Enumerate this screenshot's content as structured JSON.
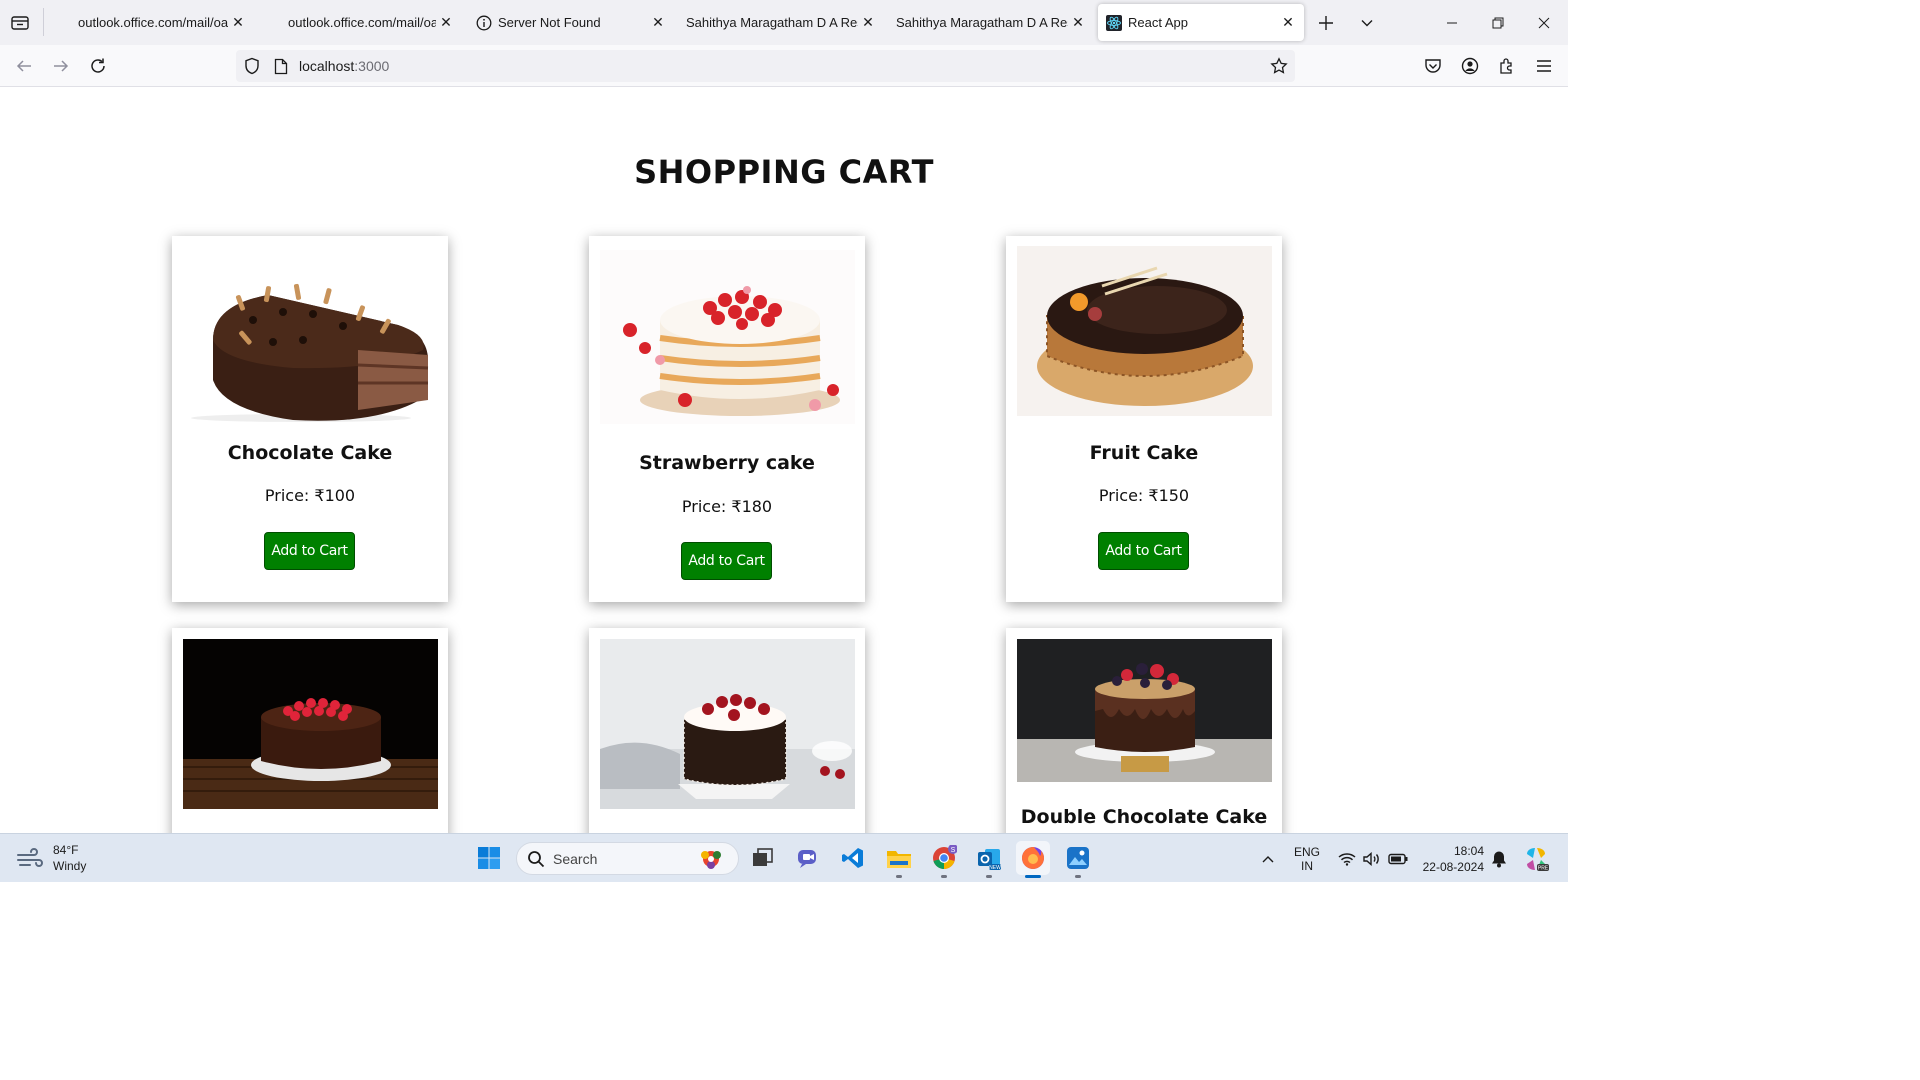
{
  "browser": {
    "tabs": [
      {
        "title": "outlook.office.com/mail/oauth",
        "favicon": "blank"
      },
      {
        "title": "outlook.office.com/mail/oauth",
        "favicon": "blank"
      },
      {
        "title": "Server Not Found",
        "favicon": "info-icon"
      },
      {
        "title": "Sahithya Maragatham D A Resume",
        "favicon": "blank"
      },
      {
        "title": "Sahithya Maragatham D A Resume",
        "favicon": "blank"
      },
      {
        "title": "React App",
        "favicon": "react-icon"
      }
    ],
    "url_host": "localhost",
    "url_port": ":3000"
  },
  "page": {
    "title": "SHOPPING CART",
    "products": [
      {
        "name": "Chocolate Cake",
        "price": "Price: ₹100",
        "button": "Add to Cart"
      },
      {
        "name": "Strawberry cake",
        "price": "Price: ₹180",
        "button": "Add to Cart"
      },
      {
        "name": "Fruit Cake",
        "price": "Price: ₹150",
        "button": "Add to Cart"
      },
      {
        "name": "",
        "price": "",
        "button": ""
      },
      {
        "name": "",
        "price": "",
        "button": ""
      },
      {
        "name": "Double Chocolate Cake",
        "price": "",
        "button": ""
      }
    ]
  },
  "taskbar": {
    "weather_temp": "84°F",
    "weather_desc": "Windy",
    "search_placeholder": "Search",
    "lang_line1": "ENG",
    "lang_line2": "IN",
    "time": "18:04",
    "date": "22-08-2024"
  },
  "colors": {
    "add_button": "#008000",
    "tab_strip": "#f0f0f4",
    "taskbar": "#dfe7f2"
  }
}
